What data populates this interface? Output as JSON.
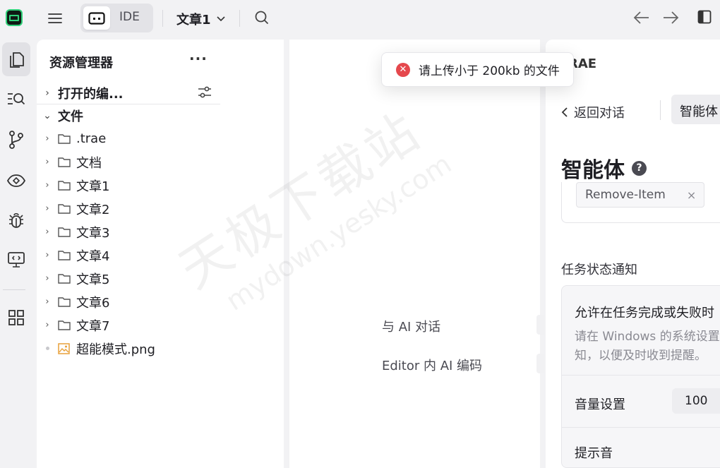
{
  "topbar": {
    "mode_ide_label": "IDE",
    "project_name": "文章1"
  },
  "explorer": {
    "title": "资源管理器",
    "more": "···",
    "open_editors_label": "打开的编...",
    "files_label": "文件",
    "items": [
      {
        "name": ".trae",
        "type": "folder"
      },
      {
        "name": "文档",
        "type": "folder"
      },
      {
        "name": "文章1",
        "type": "folder"
      },
      {
        "name": "文章2",
        "type": "folder"
      },
      {
        "name": "文章3",
        "type": "folder"
      },
      {
        "name": "文章4",
        "type": "folder"
      },
      {
        "name": "文章5",
        "type": "folder"
      },
      {
        "name": "文章6",
        "type": "folder"
      },
      {
        "name": "文章7",
        "type": "folder"
      },
      {
        "name": "超能模式.png",
        "type": "image"
      }
    ]
  },
  "editor": {
    "hint_chat": "与 AI 对话",
    "hint_code": "Editor 内 AI 编码"
  },
  "toast": {
    "message": "请上传小于 200kb 的文件"
  },
  "right_panel": {
    "brand_partial": "RAE",
    "back_label": "返回对话",
    "agent_chip": "智能体",
    "section_title": "智能体",
    "tag_label": "Remove-Item",
    "tag_close": "×",
    "notify_section": "任务状态通知",
    "allow_notify": "允许在任务完成或失败时",
    "notify_desc_1": "请在 Windows 的系统设置",
    "notify_desc_2": "知，以便及时收到提醒。",
    "volume_label": "音量设置",
    "volume_value": "100",
    "sound_label": "提示音"
  },
  "watermark": {
    "cn": "天极下载站",
    "en": "mydown.yesky.com"
  },
  "colors": {
    "accent_green": "#31d17a",
    "error_red": "#e5484d",
    "image_icon": "#e8a13a"
  },
  "icons": [
    "app-logo-icon",
    "menu-icon",
    "solo-mode-icon",
    "chevron-down-icon",
    "search-icon",
    "arrow-left-icon",
    "arrow-right-icon",
    "sidebar-layout-icon",
    "files-icon",
    "search-list-icon",
    "source-control-icon",
    "preview-eye-icon",
    "debug-bug-icon",
    "remote-monitor-icon",
    "extensions-grid-icon",
    "filter-sliders-icon",
    "folder-icon",
    "image-file-icon",
    "error-icon",
    "chevron-left-icon",
    "help-icon",
    "close-icon"
  ]
}
